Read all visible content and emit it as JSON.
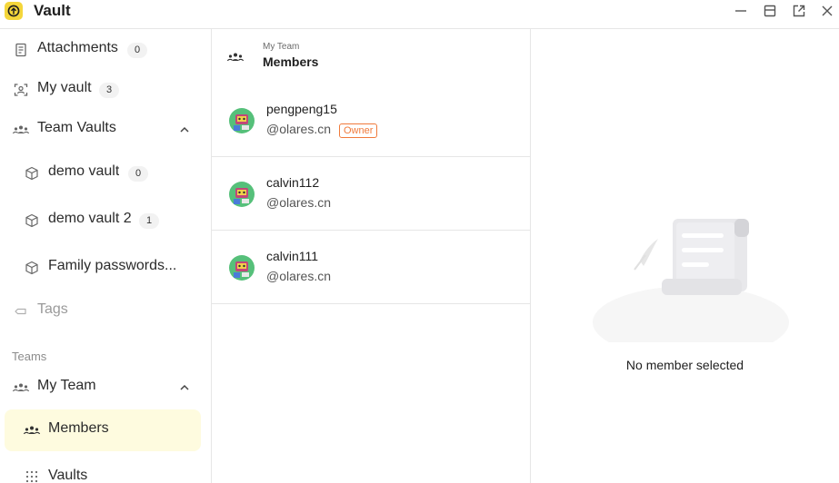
{
  "app": {
    "title": "Vault",
    "accent": "#f4d63b"
  },
  "window_controls": [
    {
      "icon": "minimize-icon"
    },
    {
      "icon": "maximize-icon"
    },
    {
      "icon": "popout-icon"
    },
    {
      "icon": "close-icon"
    }
  ],
  "sidebar": {
    "attachments": {
      "label": "Attachments",
      "count": "0",
      "icon": "document-icon"
    },
    "my_vault": {
      "label": "My vault",
      "count": "3",
      "icon": "user-scan-icon"
    },
    "team_vaults": {
      "label": "Team Vaults",
      "icon": "team-icon"
    },
    "vaults": [
      {
        "label": "demo vault",
        "count": "0",
        "icon": "cube-icon"
      },
      {
        "label": "demo vault 2",
        "count": "1",
        "icon": "cube-icon"
      },
      {
        "label": "Family passwords...",
        "icon": "cube-icon"
      }
    ],
    "tags": {
      "label": "Tags",
      "icon": "tag-icon"
    },
    "teams_section": "Teams",
    "my_team": {
      "label": "My Team",
      "icon": "team-icon"
    },
    "members": {
      "label": "Members",
      "icon": "members-icon",
      "active": true
    },
    "team_vaults_item": {
      "label": "Vaults",
      "icon": "grid-dots-icon"
    }
  },
  "list": {
    "subtitle": "My Team",
    "title": "Members",
    "members": [
      {
        "name": "pengpeng15",
        "domain": "@olares.cn",
        "badge": "Owner"
      },
      {
        "name": "calvin112",
        "domain": "@olares.cn"
      },
      {
        "name": "calvin111",
        "domain": "@olares.cn"
      }
    ]
  },
  "detail": {
    "empty_text": "No member selected"
  }
}
